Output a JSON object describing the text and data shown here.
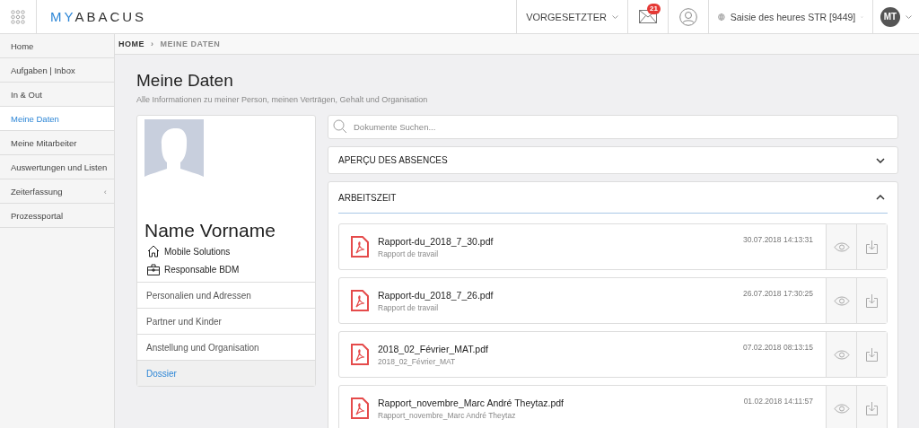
{
  "header": {
    "logo": {
      "prefix": "MY",
      "name": "ABACUS"
    },
    "role_menu": "VORGESETZTER",
    "messages_badge": "21",
    "language_menu": "Saisie des heures STR [9449]",
    "avatar": "MT"
  },
  "sidebar": {
    "items": [
      {
        "label": "Home",
        "selected": false
      },
      {
        "label": "Aufgaben | Inbox",
        "selected": false
      },
      {
        "label": "In & Out",
        "selected": false
      },
      {
        "label": "Meine Daten",
        "selected": true
      },
      {
        "label": "Meine Mitarbeiter",
        "selected": false
      },
      {
        "label": "Auswertungen und Listen",
        "selected": false
      },
      {
        "label": "Zeiterfassung",
        "selected": false,
        "caret": "‹"
      },
      {
        "label": "Prozessportal",
        "selected": false
      }
    ]
  },
  "breadcrumb": [
    "HOME",
    "MEINE DATEN"
  ],
  "breadcrumb_separator": "›",
  "page": {
    "title": "Meine Daten",
    "subtitle": "Alle Informationen zu meiner Person, meinen Verträgen, Gehalt und Organisation"
  },
  "profile": {
    "name": "Name Vorname",
    "details": [
      {
        "kind": "house",
        "text": "Mobile Solutions"
      },
      {
        "kind": "briefcase",
        "text": "Responsable BDM"
      }
    ],
    "menu": [
      {
        "label": "Personalien und Adressen",
        "selected": false
      },
      {
        "label": "Partner und Kinder",
        "selected": false
      },
      {
        "label": "Anstellung und Organisation",
        "selected": false
      },
      {
        "label": "Dossier",
        "selected": true
      }
    ]
  },
  "search": {
    "placeholder": "Dokumente Suchen..."
  },
  "sections": [
    {
      "title": "APERÇU DES ABSENCES",
      "expanded": false
    },
    {
      "title": "ARBEITSZEIT",
      "expanded": true,
      "documents": [
        {
          "file": "Rapport-du_2018_7_30.pdf",
          "description": "Rapport de travail",
          "date": "30.07.2018 14:13:31"
        },
        {
          "file": "Rapport-du_2018_7_26.pdf",
          "description": "Rapport de travail",
          "date": "26.07.2018 17:30:25"
        },
        {
          "file": "2018_02_Février_MAT.pdf",
          "description": "2018_02_Février_MAT",
          "date": "07.02.2018 08:13:15"
        },
        {
          "file": "Rapport_novembre_Marc André Theytaz.pdf",
          "description": "Rapport_novembre_Marc André Theytaz",
          "date": "01.02.2018 14:11:57"
        }
      ]
    }
  ]
}
